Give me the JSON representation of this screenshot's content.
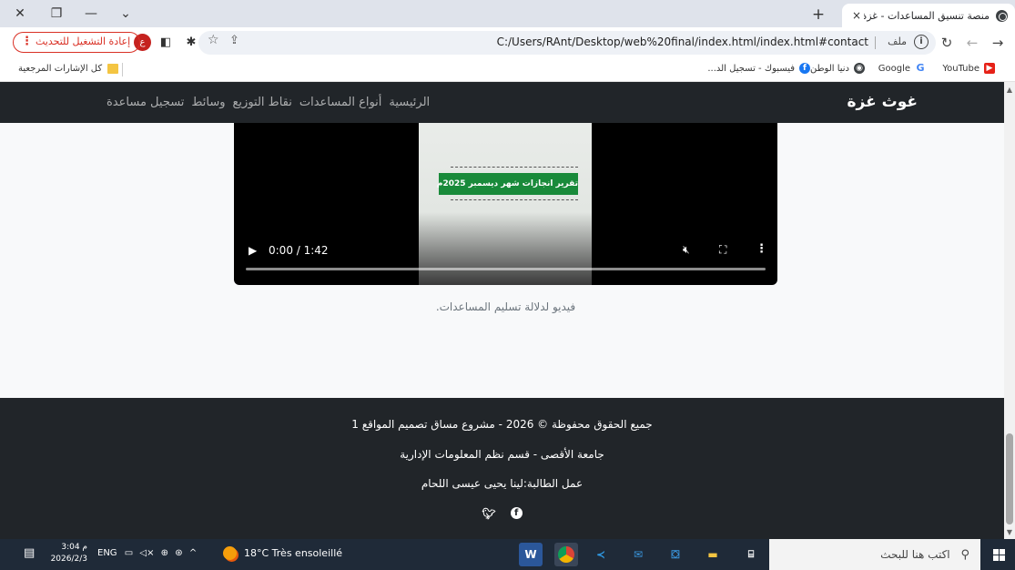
{
  "browser": {
    "tab_title": "منصة تنسيق المساعدات - غزة",
    "tab_close": "×",
    "new_tab": "+",
    "url": "C:/Users/RAnt/Desktop/web%20final/index.html/index.html#contact",
    "file_chip": "ملف",
    "update_button": "إعادة التشغيل للتحديث",
    "profile_initial": "ع",
    "window_close": "✕",
    "window_restore": "❐",
    "window_minimize": "—",
    "tab_search": "⌄"
  },
  "bookmarks": {
    "items": [
      {
        "label": "YouTube",
        "icon": "youtube-icon"
      },
      {
        "label": "Google",
        "icon": "google-icon"
      },
      {
        "label": "دنيا الوطن",
        "icon": "globe-icon"
      },
      {
        "label": "فيسبوك - تسجيل الد...",
        "icon": "facebook-icon"
      }
    ],
    "all_bookmarks": "كل الإشارات المرجعية"
  },
  "site": {
    "brand": "غوث غزة",
    "nav": [
      "الرئيسية",
      "أنواع المساعدات",
      "نقاط التوزيع",
      "وسائط",
      "تسجيل مساعدة"
    ],
    "video": {
      "banner_text": "تقرير انجازات شهر ديسمبر 2025م",
      "time": "0:00 / 1:42",
      "progress": 0
    },
    "caption": "فيديو لدلالة تسليم المساعدات.",
    "footer": {
      "line1": "جميع الحقوق محفوظة © 2026 - مشروع مساق تصميم المواقع 1",
      "line2": "جامعة الأقصى - قسم نظم المعلومات الإدارية",
      "line3": "عمل الطالبة:لينا يحيى عيسى اللحام"
    }
  },
  "taskbar": {
    "search_placeholder": "اكتب هنا للبحث",
    "weather": "18°C  Très ensoleillé",
    "lang": "ENG",
    "time": "3:04 م",
    "date": "2026/2/3"
  }
}
